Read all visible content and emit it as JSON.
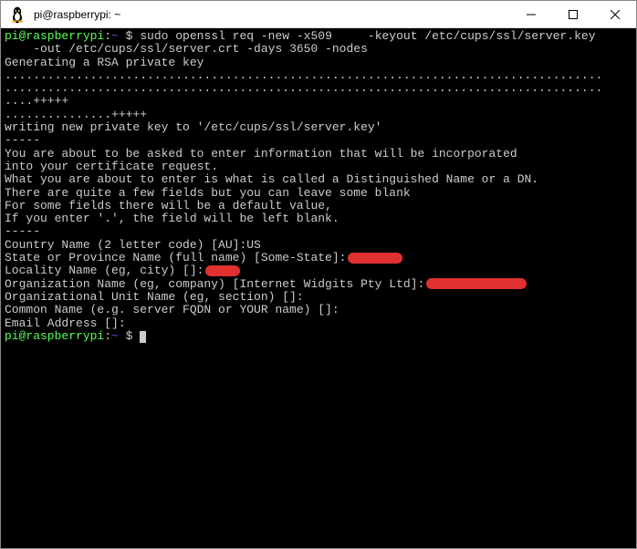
{
  "titlebar": {
    "title": "pi@raspberrypi: ~"
  },
  "prompt": {
    "user": "pi@raspberrypi",
    "sep": ":",
    "path": "~",
    "dollar": " $ "
  },
  "cmd": {
    "line1": "sudo openssl req -new -x509     -keyout /etc/cups/ssl/server.key",
    "line2": "    -out /etc/cups/ssl/server.crt -days 3650 -nodes"
  },
  "output": {
    "l1": "Generating a RSA private key",
    "l2": "....................................................................................",
    "l3": "....................................................................................",
    "l4": "....+++++",
    "l5": "...............+++++",
    "l6": "writing new private key to '/etc/cups/ssl/server.key'",
    "l7": "-----",
    "l8": "You are about to be asked to enter information that will be incorporated",
    "l9": "into your certificate request.",
    "l10": "What you are about to enter is what is called a Distinguished Name or a DN.",
    "l11": "There are quite a few fields but you can leave some blank",
    "l12": "For some fields there will be a default value,",
    "l13": "If you enter '.', the field will be left blank.",
    "l14": "-----",
    "l15": "Country Name (2 letter code) [AU]:US",
    "l16": "State or Province Name (full name) [Some-State]:",
    "l17": "Locality Name (eg, city) []:",
    "l18": "Organization Name (eg, company) [Internet Widgits Pty Ltd]:",
    "l19": "Organizational Unit Name (eg, section) []:",
    "l20": "Common Name (e.g. server FQDN or YOUR name) []:",
    "l21": "Email Address []:"
  }
}
